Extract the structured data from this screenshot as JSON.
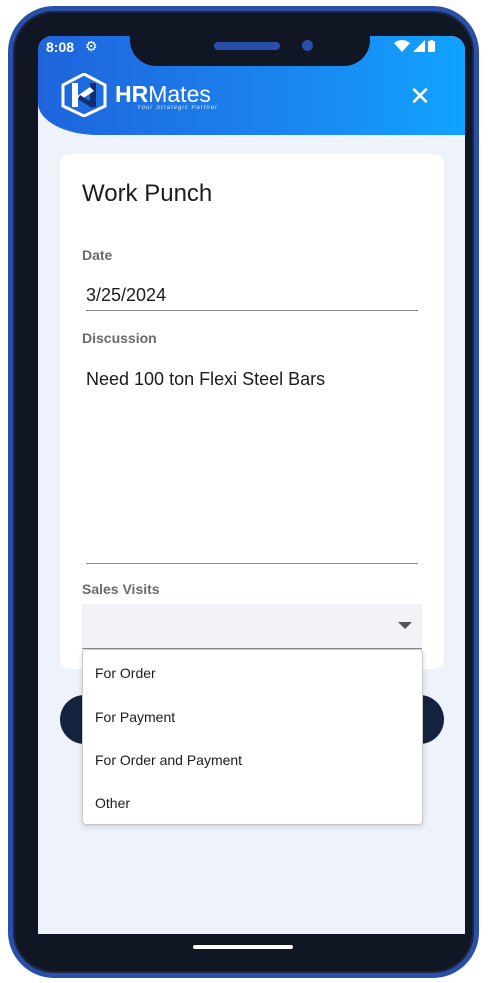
{
  "status_bar": {
    "time": "8:08"
  },
  "header": {
    "brand_bold": "HR",
    "brand_light": "Mates",
    "tagline": "Your Strategic Partner"
  },
  "form": {
    "title": "Work Punch",
    "date_label": "Date",
    "date_value": "3/25/2024",
    "discussion_label": "Discussion",
    "discussion_value": "Need 100 ton Flexi Steel Bars",
    "sales_visits_label": "Sales Visits",
    "sales_visits_value": ""
  },
  "dropdown": {
    "options": [
      "For Order",
      "For Payment",
      "For Order and Payment",
      "Other"
    ]
  },
  "colors": {
    "header_start": "#1f64dc",
    "header_end": "#11a3ff",
    "button_navy": "#16233f",
    "frame_border": "#2a4fa8"
  }
}
